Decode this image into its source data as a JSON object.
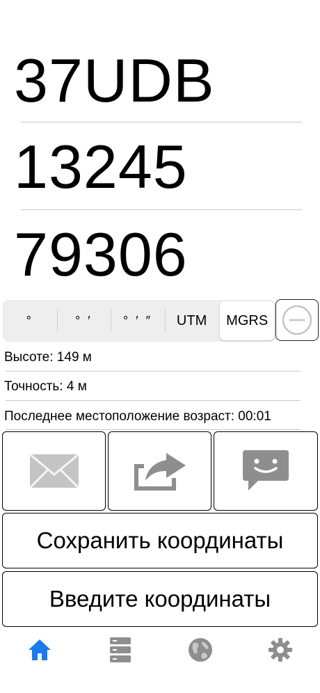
{
  "coordinates": {
    "line1": "37UDB",
    "line2": "13245",
    "line3": "79306"
  },
  "format_selector": {
    "options": [
      "°",
      "° ′",
      "° ′ ″",
      "UTM",
      "MGRS"
    ],
    "selected": "MGRS"
  },
  "info": {
    "altitude": "Высоте: 149 м",
    "accuracy": "Точность: 4 м",
    "location_age": "Последнее местоположение возраст: 00:01"
  },
  "actions": {
    "save_label": "Сохранить координаты",
    "enter_label": "Введите координаты"
  },
  "tabbar": {
    "tabs": [
      "home-icon",
      "database-icon",
      "globe-icon",
      "gear-icon"
    ],
    "active": "home-icon"
  },
  "colors": {
    "accent": "#1a7bea",
    "icon_gray": "#8e8e8e",
    "light_gray": "#c4c4c4"
  }
}
